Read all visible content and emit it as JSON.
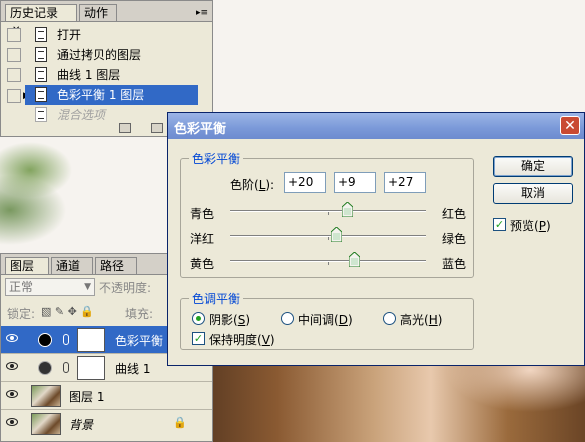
{
  "history": {
    "tabs": [
      "历史记录",
      "动作"
    ],
    "items": [
      "打开",
      "通过拷贝的图层",
      "曲线 1 图层",
      "色彩平衡 1 图层",
      "混合选项"
    ]
  },
  "layers": {
    "tabs": [
      "图层",
      "通道",
      "路径"
    ],
    "blend_mode": "正常",
    "opacity_label": "不透明度:",
    "lock_label": "锁定:",
    "fill_label": "填充:",
    "rows": [
      {
        "name": "色彩平衡"
      },
      {
        "name": "曲线 1"
      },
      {
        "name": "图层 1"
      },
      {
        "name": "背景"
      }
    ]
  },
  "dialog": {
    "title": "色彩平衡",
    "close_glyph": "✕",
    "balance_group": "色彩平衡",
    "levels_label": "色阶(",
    "levels_key": "L",
    "levels_suffix": "):",
    "levels": [
      "+20",
      "+9",
      "+27"
    ],
    "sliders": [
      {
        "left": "青色",
        "right": "红色",
        "value": 20
      },
      {
        "left": "洋红",
        "right": "绿色",
        "value": 9
      },
      {
        "left": "黄色",
        "right": "蓝色",
        "value": 27
      }
    ],
    "tone_group": "色调平衡",
    "tone_options": [
      {
        "label": "阴影(",
        "key": "S",
        "suffix": ")",
        "selected": true
      },
      {
        "label": "中间调(",
        "key": "D",
        "suffix": ")",
        "selected": false
      },
      {
        "label": "高光(",
        "key": "H",
        "suffix": ")",
        "selected": false
      }
    ],
    "preserve_label": "保持明度(",
    "preserve_key": "V",
    "preserve_suffix": ")",
    "preserve_checked": true,
    "ok_label": "确定",
    "cancel_label": "取消",
    "preview_label": "预览(",
    "preview_key": "P",
    "preview_suffix": ")",
    "preview_checked": true
  },
  "icons": [
    "document-icon",
    "eye-icon",
    "adjustment-icon",
    "link-icon",
    "lock-icon",
    "close-icon",
    "new-snapshot-icon",
    "camera-icon",
    "trash-icon"
  ]
}
